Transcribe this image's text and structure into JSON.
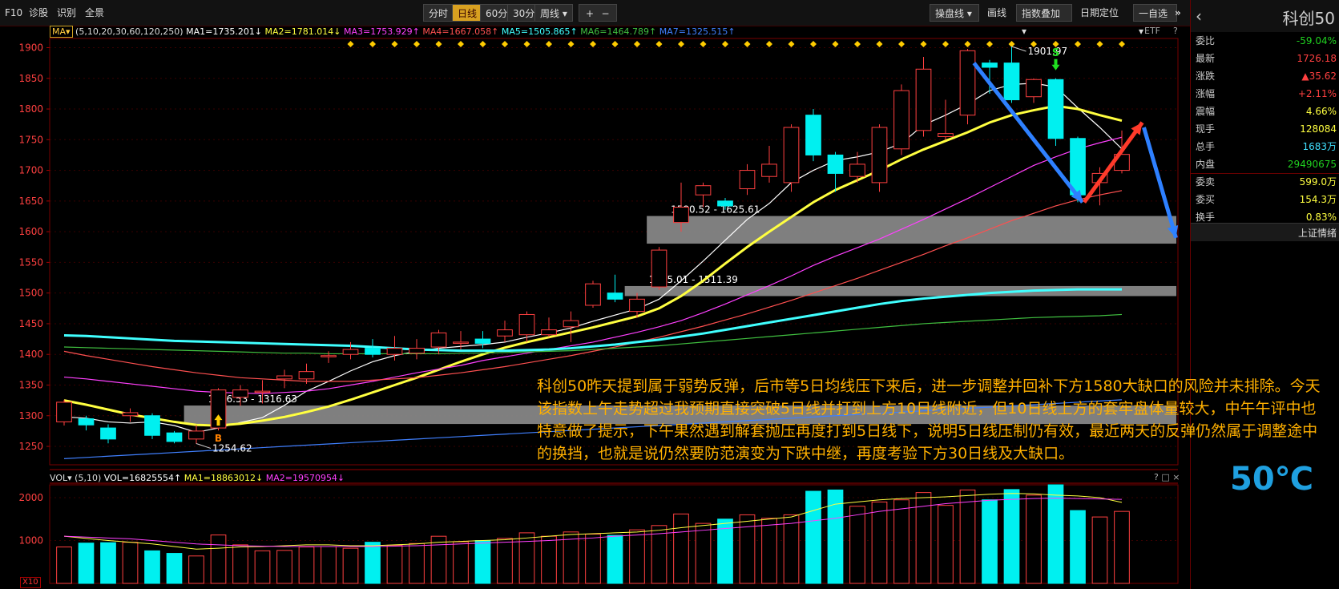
{
  "toolbar": {
    "left": [
      "F10",
      "诊股",
      "识别",
      "全景"
    ],
    "periods": [
      "分时",
      "日线",
      "60分",
      "30分",
      "周线"
    ],
    "active_period": "日线",
    "zoom_in": "+",
    "zoom_out": "−",
    "right": [
      "操盘线",
      "画线",
      "指数叠加",
      "日期定位",
      "一自选"
    ],
    "close": "»"
  },
  "ma_legend": {
    "label": "MA",
    "params": "(5,10,20,30,60,120,250)",
    "items": [
      {
        "text": "MA1=1735.201↓",
        "color": "#ffffff"
      },
      {
        "text": "MA2=1781.014↓",
        "color": "#ffff40"
      },
      {
        "text": "MA3=1753.929↑",
        "color": "#ff40ff"
      },
      {
        "text": "MA4=1667.058↑",
        "color": "#ff5050"
      },
      {
        "text": "MA5=1505.865↑",
        "color": "#40ffff"
      },
      {
        "text": "MA6=1464.789↑",
        "color": "#40c040"
      },
      {
        "text": "MA7=1325.515↑",
        "color": "#4080ff"
      }
    ],
    "etf": "ETF",
    "help": "?"
  },
  "vol_legend": {
    "label": "VOL",
    "params": "(5,10)",
    "items": [
      {
        "text": "VOL=16825554↑",
        "color": "#ffffff"
      },
      {
        "text": "MA1=18863012↓",
        "color": "#ffff40"
      },
      {
        "text": "MA2=19570954↓",
        "color": "#ff40ff"
      }
    ],
    "icons": "? □ ×",
    "scale": "X10"
  },
  "quote": {
    "title": "科创50",
    "rows": [
      {
        "k": "委比",
        "v": "-59.04%",
        "c": "#20d020"
      },
      {
        "k": "最新",
        "v": "1726.18",
        "c": "#ff4040"
      },
      {
        "k": "涨跌",
        "v": "▲35.62",
        "c": "#ff4040"
      },
      {
        "k": "涨幅",
        "v": "+2.11%",
        "c": "#ff4040"
      },
      {
        "k": "震幅",
        "v": "4.66%",
        "c": "#ffff40"
      },
      {
        "k": "现手",
        "v": "128084",
        "c": "#ffff40"
      },
      {
        "k": "总手",
        "v": "1683万",
        "c": "#40e0ff"
      },
      {
        "k": "内盘",
        "v": "29490675",
        "c": "#20d020"
      },
      {
        "k": "委卖",
        "v": "599.0万",
        "c": "#ffff40"
      },
      {
        "k": "委买",
        "v": "154.3万",
        "c": "#ffff40"
      },
      {
        "k": "换手",
        "v": "0.83%",
        "c": "#ffff40"
      }
    ],
    "market_tab": "上证情绪"
  },
  "annotation": "科创50昨天提到属于弱势反弹，后市等5日均线压下来后，进一步调整并回补下方1580大缺口的风险并未排除。今天该指数上午走势超过我预期直接突破5日线并打到上方10日线附近，但10日线上方的套牢盘体量较大，中午午评中也特意做了提示，下午果然遇到解套抛压再度打到5日线下，说明5日线压制仍有效，最近两天的反弹仍然属于调整途中的换挡，也就是说仍然要防范演变为下跌中继，再度考验下方30日线及大缺口。",
  "badge": "50℃",
  "chart_data": {
    "type": "candlestick",
    "title": "科创50",
    "price_axis": {
      "ticks": [
        1250,
        1300,
        1350,
        1400,
        1450,
        1500,
        1550,
        1600,
        1650,
        1700,
        1750,
        1800,
        1850,
        1900
      ],
      "ylim": [
        1220,
        1915
      ]
    },
    "vol_axis": {
      "ticks": [
        1000,
        2000
      ],
      "ylim": [
        0,
        2300
      ]
    },
    "candles": [
      {
        "o": 1290,
        "c": 1322,
        "h": 1326,
        "l": 1284,
        "v": 850
      },
      {
        "o": 1295,
        "c": 1285,
        "h": 1300,
        "l": 1276,
        "v": 940
      },
      {
        "o": 1280,
        "c": 1262,
        "h": 1286,
        "l": 1255,
        "v": 950
      },
      {
        "o": 1300,
        "c": 1305,
        "h": 1312,
        "l": 1290,
        "v": 960
      },
      {
        "o": 1300,
        "c": 1268,
        "h": 1304,
        "l": 1262,
        "v": 760
      },
      {
        "o": 1272,
        "c": 1258,
        "h": 1275,
        "l": 1255,
        "v": 700
      },
      {
        "o": 1262,
        "c": 1275,
        "h": 1285,
        "l": 1254,
        "v": 640
      },
      {
        "o": 1280,
        "c": 1342,
        "h": 1345,
        "l": 1276,
        "v": 1130
      },
      {
        "o": 1330,
        "c": 1342,
        "h": 1350,
        "l": 1316,
        "v": 900
      },
      {
        "o": 1340,
        "c": 1340,
        "h": 1358,
        "l": 1320,
        "v": 760
      },
      {
        "o": 1360,
        "c": 1365,
        "h": 1375,
        "l": 1345,
        "v": 770
      },
      {
        "o": 1360,
        "c": 1372,
        "h": 1385,
        "l": 1352,
        "v": 850
      },
      {
        "o": 1398,
        "c": 1398,
        "h": 1405,
        "l": 1386,
        "v": 860
      },
      {
        "o": 1400,
        "c": 1408,
        "h": 1420,
        "l": 1392,
        "v": 820
      },
      {
        "o": 1410,
        "c": 1400,
        "h": 1425,
        "l": 1395,
        "v": 960
      },
      {
        "o": 1400,
        "c": 1410,
        "h": 1430,
        "l": 1390,
        "v": 890
      },
      {
        "o": 1402,
        "c": 1410,
        "h": 1425,
        "l": 1392,
        "v": 930
      },
      {
        "o": 1412,
        "c": 1435,
        "h": 1440,
        "l": 1400,
        "v": 1100
      },
      {
        "o": 1420,
        "c": 1420,
        "h": 1438,
        "l": 1408,
        "v": 970
      },
      {
        "o": 1425,
        "c": 1418,
        "h": 1438,
        "l": 1410,
        "v": 1000
      },
      {
        "o": 1430,
        "c": 1440,
        "h": 1455,
        "l": 1420,
        "v": 1050
      },
      {
        "o": 1432,
        "c": 1465,
        "h": 1470,
        "l": 1420,
        "v": 1180
      },
      {
        "o": 1432,
        "c": 1440,
        "h": 1460,
        "l": 1428,
        "v": 1100
      },
      {
        "o": 1445,
        "c": 1455,
        "h": 1470,
        "l": 1420,
        "v": 1200
      },
      {
        "o": 1480,
        "c": 1515,
        "h": 1520,
        "l": 1476,
        "v": 1150
      },
      {
        "o": 1500,
        "c": 1490,
        "h": 1530,
        "l": 1485,
        "v": 1120
      },
      {
        "o": 1470,
        "c": 1490,
        "h": 1500,
        "l": 1460,
        "v": 1250
      },
      {
        "o": 1510,
        "c": 1570,
        "h": 1575,
        "l": 1505,
        "v": 1350
      },
      {
        "o": 1615,
        "c": 1640,
        "h": 1680,
        "l": 1600,
        "v": 1620
      },
      {
        "o": 1660,
        "c": 1675,
        "h": 1680,
        "l": 1640,
        "v": 1400
      },
      {
        "o": 1650,
        "c": 1642,
        "h": 1655,
        "l": 1636,
        "v": 1500
      },
      {
        "o": 1670,
        "c": 1700,
        "h": 1710,
        "l": 1660,
        "v": 1600
      },
      {
        "o": 1690,
        "c": 1710,
        "h": 1740,
        "l": 1680,
        "v": 1520
      },
      {
        "o": 1680,
        "c": 1770,
        "h": 1775,
        "l": 1665,
        "v": 1600
      },
      {
        "o": 1790,
        "c": 1725,
        "h": 1800,
        "l": 1715,
        "v": 2150
      },
      {
        "o": 1725,
        "c": 1695,
        "h": 1730,
        "l": 1665,
        "v": 2180
      },
      {
        "o": 1690,
        "c": 1710,
        "h": 1730,
        "l": 1680,
        "v": 1800
      },
      {
        "o": 1680,
        "c": 1770,
        "h": 1775,
        "l": 1665,
        "v": 1900
      },
      {
        "o": 1735,
        "c": 1830,
        "h": 1840,
        "l": 1725,
        "v": 1950
      },
      {
        "o": 1765,
        "c": 1865,
        "h": 1885,
        "l": 1755,
        "v": 2120
      },
      {
        "o": 1755,
        "c": 1760,
        "h": 1815,
        "l": 1750,
        "v": 1820
      },
      {
        "o": 1790,
        "c": 1895,
        "h": 1898,
        "l": 1775,
        "v": 2180
      },
      {
        "o": 1875,
        "c": 1868,
        "h": 1880,
        "l": 1825,
        "v": 1950
      },
      {
        "o": 1875,
        "c": 1815,
        "h": 1901.97,
        "l": 1810,
        "v": 2190
      },
      {
        "o": 1820,
        "c": 1848,
        "h": 1850,
        "l": 1810,
        "v": 2060
      },
      {
        "o": 1848,
        "c": 1752,
        "h": 1850,
        "l": 1740,
        "v": 2300
      },
      {
        "o": 1752,
        "c": 1660,
        "h": 1755,
        "l": 1648,
        "v": 1700
      },
      {
        "o": 1680,
        "c": 1695,
        "h": 1705,
        "l": 1643,
        "v": 1550
      },
      {
        "o": 1700,
        "c": 1726,
        "h": 1765,
        "l": 1695,
        "v": 1680
      }
    ],
    "ma_series": [
      {
        "name": "MA1",
        "color": "#ffffff",
        "values": [
          1298,
          1296,
          1290,
          1288,
          1290,
          1284,
          1273,
          1280,
          1289,
          1297,
          1317,
          1340,
          1356,
          1373,
          1388,
          1398,
          1405,
          1410,
          1413,
          1416,
          1420,
          1428,
          1435,
          1443,
          1454,
          1464,
          1474,
          1490,
          1520,
          1552,
          1586,
          1620,
          1646,
          1680,
          1700,
          1716,
          1722,
          1730,
          1744,
          1774,
          1790,
          1808,
          1830,
          1840,
          1842,
          1836,
          1802,
          1770,
          1735
        ]
      },
      {
        "name": "MA2",
        "color": "#ffff40",
        "values": [
          1325,
          1318,
          1310,
          1302,
          1296,
          1290,
          1285,
          1284,
          1287,
          1292,
          1298,
          1306,
          1315,
          1326,
          1338,
          1350,
          1362,
          1375,
          1388,
          1400,
          1411,
          1420,
          1428,
          1436,
          1444,
          1453,
          1462,
          1475,
          1495,
          1520,
          1548,
          1575,
          1600,
          1624,
          1648,
          1668,
          1684,
          1700,
          1718,
          1734,
          1748,
          1762,
          1778,
          1790,
          1798,
          1805,
          1800,
          1790,
          1781
        ]
      },
      {
        "name": "MA3",
        "color": "#ff40ff",
        "values": [
          1363,
          1360,
          1356,
          1352,
          1348,
          1344,
          1340,
          1338,
          1337,
          1336,
          1338,
          1340,
          1344,
          1350,
          1356,
          1363,
          1370,
          1376,
          1382,
          1390,
          1396,
          1402,
          1408,
          1414,
          1420,
          1428,
          1436,
          1445,
          1455,
          1468,
          1482,
          1497,
          1512,
          1528,
          1545,
          1560,
          1574,
          1588,
          1604,
          1620,
          1637,
          1654,
          1672,
          1690,
          1708,
          1722,
          1735,
          1745,
          1754
        ]
      },
      {
        "name": "MA4",
        "color": "#ff5050",
        "values": [
          1405,
          1398,
          1392,
          1386,
          1380,
          1375,
          1370,
          1366,
          1362,
          1360,
          1358,
          1356,
          1356,
          1356,
          1358,
          1360,
          1362,
          1366,
          1370,
          1375,
          1380,
          1386,
          1392,
          1398,
          1405,
          1412,
          1420,
          1428,
          1437,
          1446,
          1456,
          1466,
          1477,
          1488,
          1500,
          1512,
          1524,
          1537,
          1550,
          1563,
          1577,
          1590,
          1604,
          1618,
          1630,
          1642,
          1652,
          1660,
          1667
        ]
      },
      {
        "name": "MA5",
        "color": "#40ffff",
        "values": [
          1431,
          1430,
          1428,
          1426,
          1424,
          1422,
          1421,
          1420,
          1419,
          1418,
          1417,
          1416,
          1415,
          1414,
          1412,
          1410,
          1408,
          1407,
          1406,
          1406,
          1406,
          1407,
          1408,
          1410,
          1413,
          1416,
          1420,
          1424,
          1429,
          1434,
          1440,
          1446,
          1452,
          1458,
          1464,
          1470,
          1476,
          1482,
          1487,
          1491,
          1494,
          1497,
          1500,
          1502,
          1504,
          1505,
          1506,
          1506,
          1506
        ]
      },
      {
        "name": "MA6",
        "color": "#40c040",
        "values": [
          1412,
          1411,
          1410,
          1409,
          1408,
          1407,
          1406,
          1405,
          1404,
          1403,
          1402,
          1402,
          1401,
          1401,
          1401,
          1401,
          1401,
          1401,
          1402,
          1402,
          1403,
          1404,
          1405,
          1406,
          1408,
          1410,
          1412,
          1414,
          1417,
          1420,
          1423,
          1426,
          1429,
          1432,
          1435,
          1438,
          1441,
          1444,
          1447,
          1450,
          1452,
          1454,
          1456,
          1458,
          1460,
          1461,
          1462,
          1463,
          1465
        ]
      },
      {
        "name": "MA7",
        "color": "#4080ff",
        "values": [
          1230,
          1232,
          1234,
          1236,
          1238,
          1240,
          1242,
          1244,
          1246,
          1248,
          1250,
          1252,
          1254,
          1256,
          1258,
          1260,
          1262,
          1264,
          1266,
          1268,
          1270,
          1272,
          1274,
          1276,
          1278,
          1280,
          1282,
          1284,
          1286,
          1288,
          1290,
          1292,
          1294,
          1296,
          1298,
          1300,
          1302,
          1304,
          1306,
          1308,
          1310,
          1312,
          1314,
          1316,
          1318,
          1320,
          1322,
          1324,
          1326
        ]
      }
    ],
    "vol_ma": [
      {
        "name": "MA1",
        "color": "#ffff40",
        "values": [
          1100,
          1050,
          1000,
          960,
          920,
          860,
          800,
          820,
          850,
          860,
          880,
          900,
          900,
          880,
          880,
          900,
          920,
          960,
          980,
          1000,
          1020,
          1060,
          1100,
          1140,
          1160,
          1180,
          1200,
          1240,
          1300,
          1350,
          1400,
          1450,
          1500,
          1550,
          1700,
          1850,
          1900,
          1950,
          1980,
          2000,
          2020,
          2050,
          2080,
          2100,
          2090,
          2060,
          2040,
          2000,
          1890
        ]
      },
      {
        "name": "MA2",
        "color": "#ff40ff",
        "values": [
          1100,
          1080,
          1060,
          1040,
          1000,
          960,
          920,
          900,
          880,
          870,
          860,
          860,
          860,
          860,
          860,
          870,
          880,
          900,
          920,
          940,
          960,
          980,
          1000,
          1030,
          1060,
          1100,
          1130,
          1160,
          1200,
          1240,
          1280,
          1320,
          1360,
          1400,
          1460,
          1520,
          1600,
          1680,
          1740,
          1800,
          1860,
          1900,
          1940,
          1960,
          1980,
          1990,
          1980,
          1970,
          1960
        ]
      }
    ],
    "gaps": [
      {
        "low": 1580.52,
        "high": 1625.61,
        "label": "1580.52 - 1625.61",
        "from": 27
      },
      {
        "low": 1495.01,
        "high": 1511.39,
        "label": "1495.01 - 1511.39",
        "from": 26
      },
      {
        "low": 1286.53,
        "high": 1316.63,
        "label": "1286.53 - 1316.63",
        "from": 6
      }
    ],
    "point_labels": [
      {
        "idx": 43,
        "value": 1901.97,
        "text": "1901.97"
      },
      {
        "idx": 6,
        "value": 1254.62,
        "text": "1254.62"
      }
    ],
    "signals": [
      {
        "idx": 7,
        "text": "B",
        "color": "#ffcc00"
      },
      {
        "idx": 45,
        "text": "S",
        "color": "#20e020"
      }
    ]
  }
}
